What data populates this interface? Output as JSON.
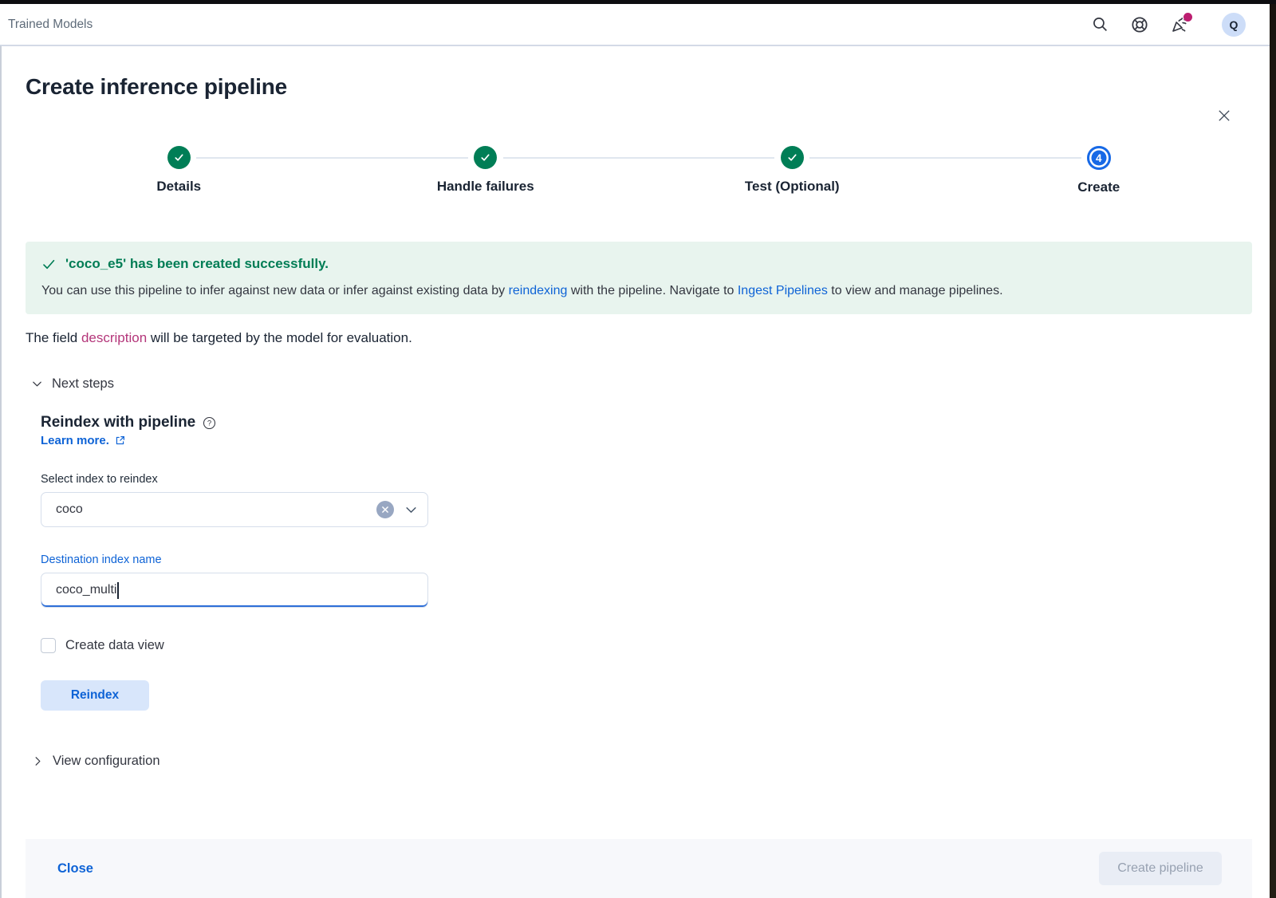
{
  "header": {
    "breadcrumb": "Trained Models",
    "icons": [
      "search-icon",
      "help-icon",
      "newsfeed-icon"
    ],
    "avatar_initial": "Q"
  },
  "flyout": {
    "title": "Create inference pipeline",
    "steps": [
      {
        "label": "Details",
        "status": "complete"
      },
      {
        "label": "Handle failures",
        "status": "complete"
      },
      {
        "label": "Test (Optional)",
        "status": "complete"
      },
      {
        "label": "Create",
        "status": "current",
        "number": "4"
      }
    ],
    "callout": {
      "title": "'coco_e5' has been created successfully.",
      "body": {
        "before": "You can use this pipeline to infer against new data or infer against existing data by ",
        "link1": "reindexing",
        "middle": " with the pipeline. Navigate to ",
        "link2": "Ingest Pipelines",
        "after": " to view and manage pipelines."
      }
    },
    "target_line": {
      "before": "The field ",
      "field": "description",
      "after": " will be targeted by the model for evaluation."
    },
    "next_steps_label": "Next steps",
    "reindex": {
      "heading": "Reindex with pipeline",
      "learn_more": "Learn more.",
      "select_label": "Select index to reindex",
      "selected_index": "coco",
      "destination_label": "Destination index name",
      "destination_value": "coco_multi",
      "checkbox_label": "Create data view",
      "button_label": "Reindex"
    },
    "view_config_label": "View configuration",
    "footer": {
      "close_label": "Close",
      "create_label": "Create pipeline"
    }
  },
  "colors": {
    "primary_blue": "#0e63d6",
    "step_blue": "#1769e6",
    "success_green": "#007e56",
    "callout_bg": "#e8f4ee",
    "accent_pink": "#b4367a",
    "badge_magenta": "#bc1e70",
    "border": "#d3dae6",
    "footer_bg": "#f7f8fb"
  }
}
